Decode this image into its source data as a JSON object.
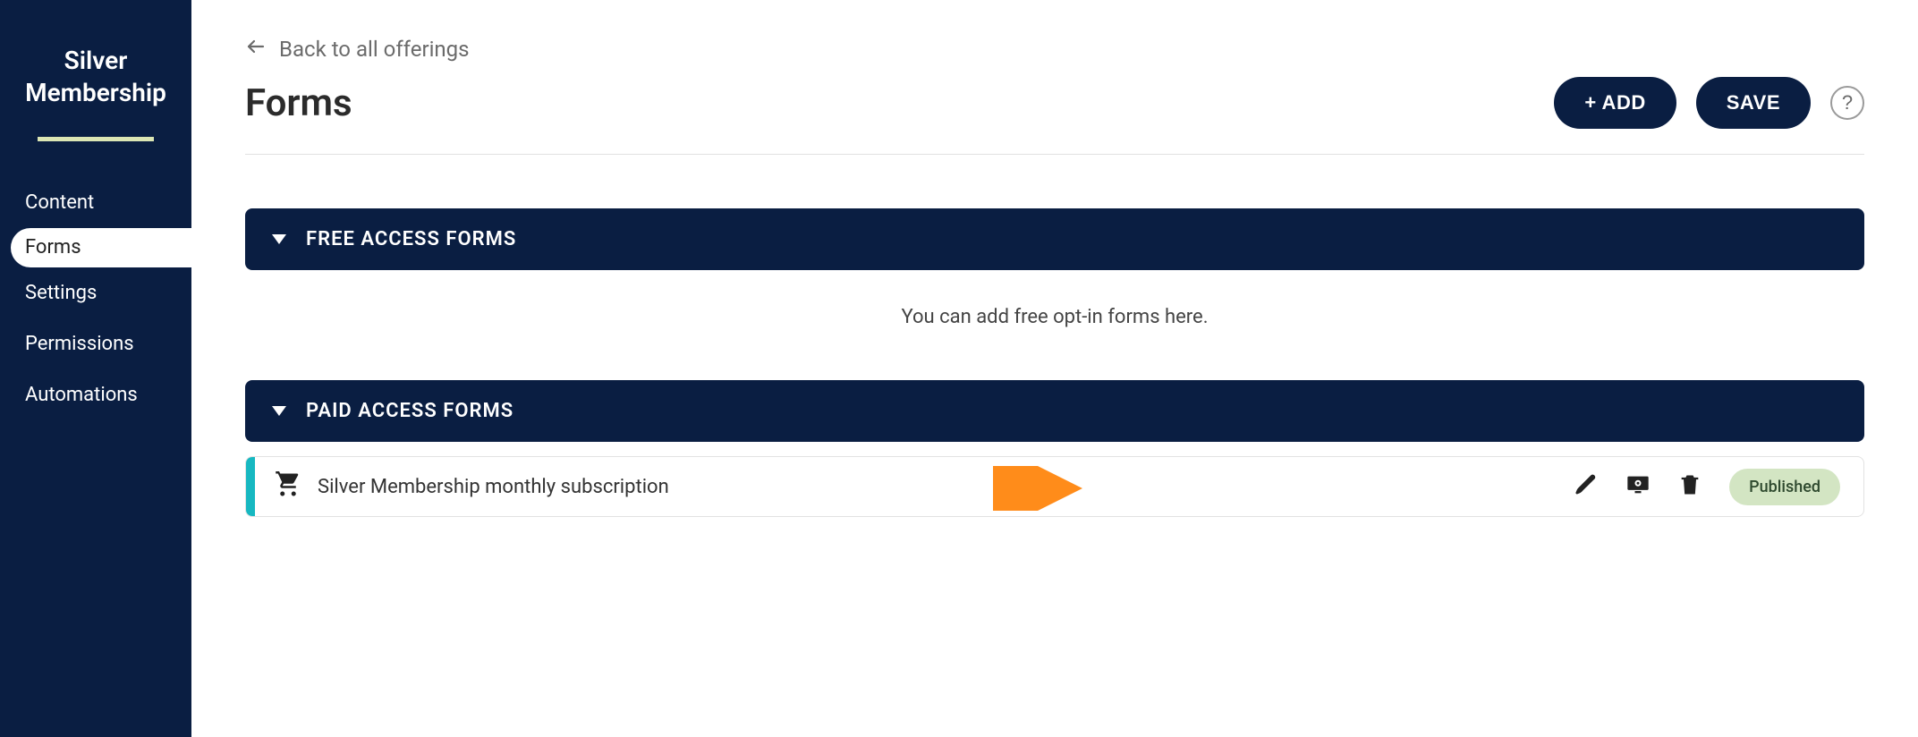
{
  "sidebar": {
    "title_line1": "Silver",
    "title_line2": "Membership",
    "items": [
      {
        "label": "Content",
        "active": false
      },
      {
        "label": "Forms",
        "active": true
      },
      {
        "label": "Settings",
        "active": false
      },
      {
        "label": "Permissions",
        "active": false
      },
      {
        "label": "Automations",
        "active": false
      }
    ]
  },
  "header": {
    "back_label": "Back to all offerings",
    "page_title": "Forms",
    "add_label": "+ ADD",
    "save_label": "SAVE",
    "help_label": "?"
  },
  "sections": {
    "free": {
      "title": "FREE ACCESS FORMS",
      "empty_text": "You can add free opt-in forms here."
    },
    "paid": {
      "title": "PAID ACCESS FORMS",
      "rows": [
        {
          "label": "Silver Membership monthly subscription",
          "status": "Published",
          "accent_color": "#17b8c1"
        }
      ]
    }
  },
  "annotation": {
    "arrow_color": "#ff8c1a"
  }
}
